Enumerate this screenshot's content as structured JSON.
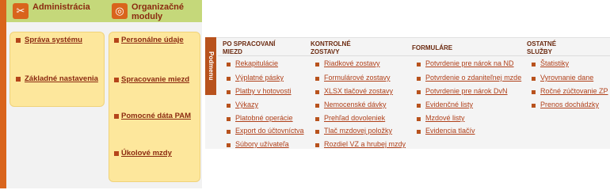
{
  "modules": {
    "admin": {
      "title": "Administrácia",
      "icon": "tools-icon",
      "items": [
        "Správa systému",
        "Základné nastavenia"
      ]
    },
    "org": {
      "title_line1": "Organizačné",
      "title_line2": "moduly",
      "icon": "modules-icon",
      "items": [
        "Personálne údaje",
        "Spracovanie miezd",
        "Pomocné dáta PAM",
        "Úkolové mzdy"
      ]
    }
  },
  "panel": {
    "tab_label": "Podmenu",
    "columns": [
      {
        "header_line1": "PO SPRACOVANÍ",
        "header_line2": "MIEZD",
        "items": [
          "Rekapitulácie",
          "Výplatné pásky",
          "Platby v hotovosti",
          "Výkazy",
          "Platobné operácie",
          "Export do účtovníctva",
          "Súbory užívateľa"
        ]
      },
      {
        "header_line1": "KONTROLNÉ",
        "header_line2": "ZOSTAVY",
        "items": [
          "Riadkové zostavy",
          "Formulárové zostavy",
          "XLSX tlačové zostavy",
          "Nemocenské dávky",
          "Prehľad dovoleniek",
          "Tlač mzdovej položky",
          "Rozdiel VZ a hrubej mzdy"
        ]
      },
      {
        "header_line1": "FORMULÁRE",
        "header_line2": "",
        "items": [
          "Potvrdenie pre nárok na ND",
          "Potvrdenie o zdaniteľnej mzde",
          "Potvrdenie pre nárok DvN",
          "Evidenčné listy",
          "Mzdové listy",
          "Evidencia tlačív"
        ]
      },
      {
        "header_line1": "OSTATNÉ",
        "header_line2": "SLUŽBY",
        "items": [
          "Štatistiky",
          "Vyrovnanie dane",
          "Ročné zúčtovanie ZP",
          "Prenos dochádzky"
        ]
      }
    ]
  },
  "colors": {
    "accent": "#d9641c",
    "header_green": "#c5d87a",
    "card": "#fde79c",
    "link": "#b0401a"
  }
}
